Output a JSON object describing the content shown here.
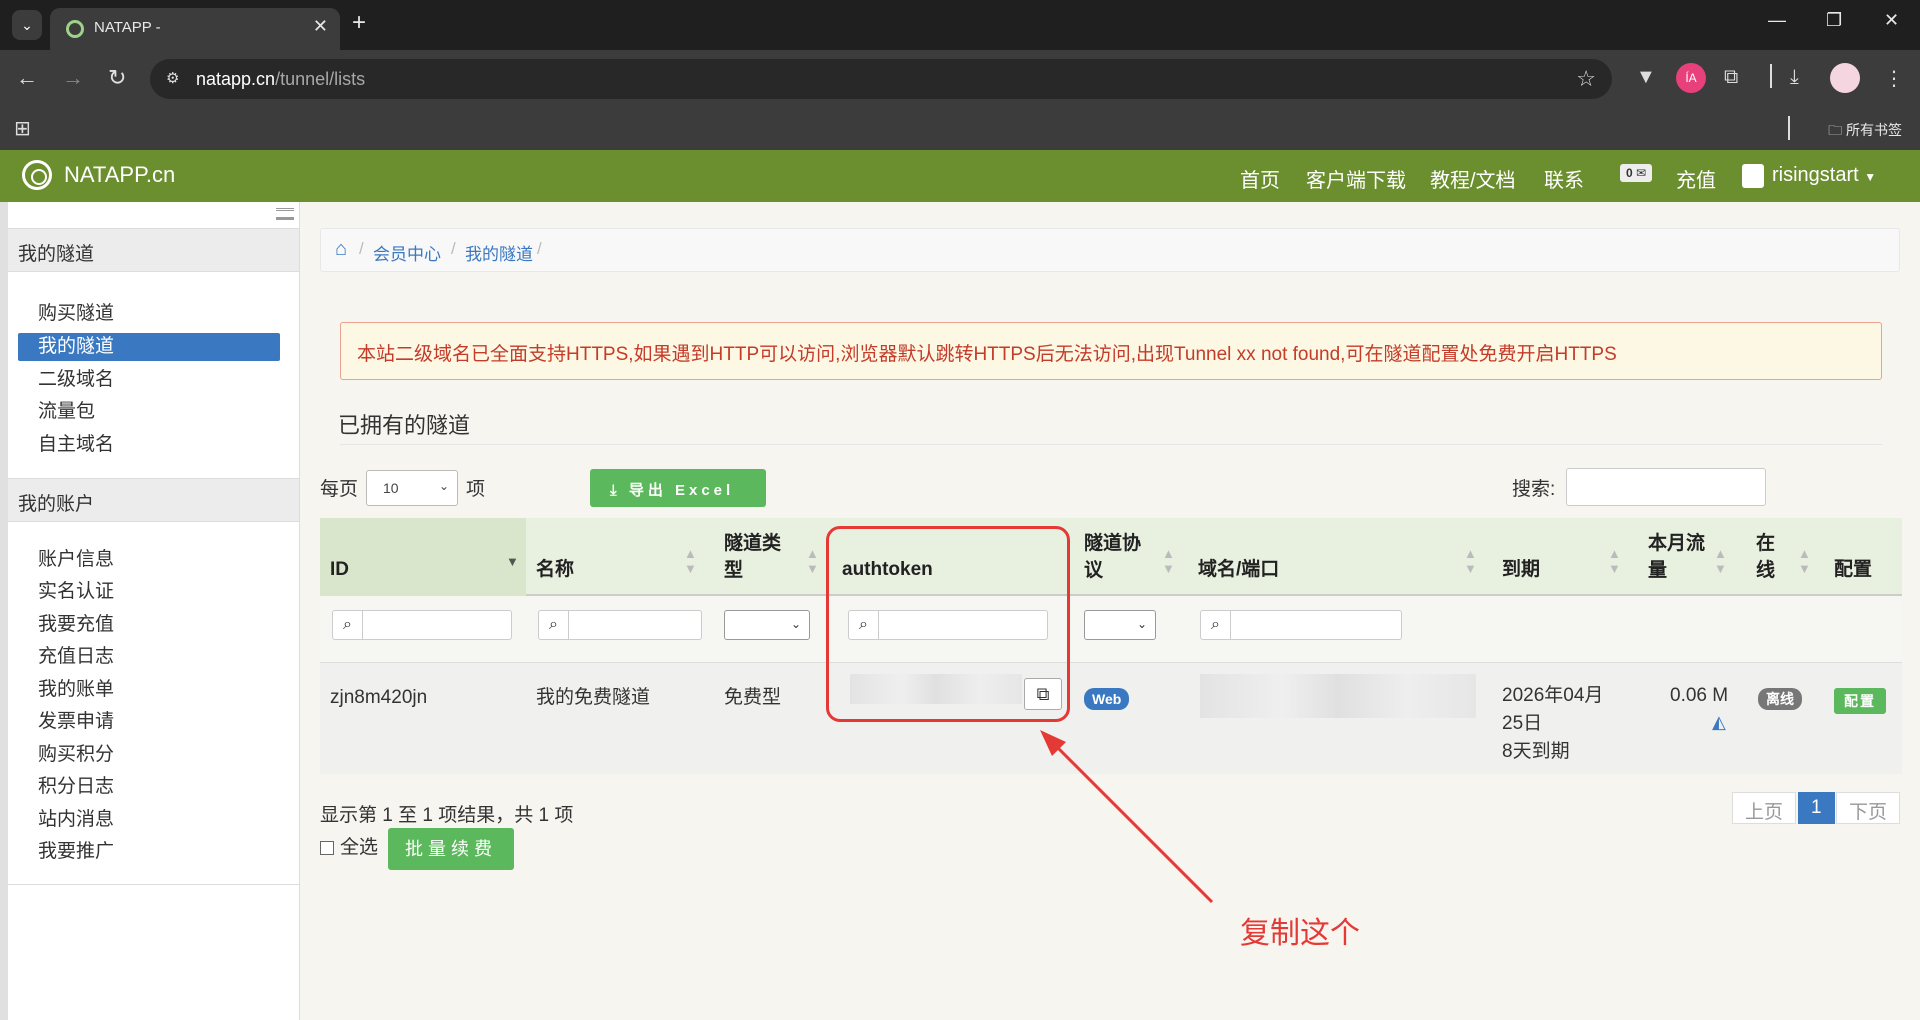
{
  "browser": {
    "tab_title": "NATAPP -",
    "tab_close": "✕",
    "tab_new": "+",
    "url_host": "natapp.cn",
    "url_path": "/tunnel/lists",
    "bookmark_all": "所有书签",
    "ext_badge_text": "ÍA"
  },
  "site": {
    "brand": "NATAPP.cn",
    "nav": [
      "首页",
      "客户端下载",
      "教程/文档",
      "联系"
    ],
    "wallet_count": "0",
    "recharge": "充值",
    "username": "risingstart",
    "colors": {
      "header": "#6b8e2f",
      "accent": "#3a78c2",
      "success": "#5cb85c",
      "alert_text": "#c43b2a",
      "annotation": "#e53935"
    }
  },
  "sidebar": {
    "group1": "我的隧道",
    "group1_items": [
      "购买隧道",
      "我的隧道",
      "二级域名",
      "流量包",
      "自主域名"
    ],
    "active": "我的隧道",
    "group2": "我的账户",
    "group2_items": [
      "账户信息",
      "实名认证",
      "我要充值",
      "充值日志",
      "我的账单",
      "发票申请",
      "购买积分",
      "积分日志",
      "站内消息",
      "我要推广"
    ]
  },
  "breadcrumb": [
    "会员中心",
    "我的隧道"
  ],
  "alert": "本站二级域名已全面支持HTTPS,如果遇到HTTP可以访问,浏览器默认跳转HTTPS后无法访问,出现Tunnel xx not found,可在隧道配置处免费开启HTTPS",
  "section_title": "已拥有的隧道",
  "controls": {
    "per_page_prefix": "每页",
    "per_page_value": "10",
    "per_page_suffix": "项",
    "export_label": "导出 Excel",
    "search_label": "搜索:"
  },
  "table": {
    "headers": {
      "id": "ID",
      "name": "名称",
      "type_l1": "隧道类",
      "type_l2": "型",
      "authtoken": "authtoken",
      "proto_l1": "隧道协",
      "proto_l2": "议",
      "domain": "域名/端口",
      "expire": "到期",
      "traffic_l1": "本月流",
      "traffic_l2": "量",
      "online_l1": "在",
      "online_l2": "线",
      "config": "配置"
    },
    "row": {
      "id": "zjn8m420jn",
      "name": "我的免费隧道",
      "type": "免费型",
      "protocol": "Web",
      "expire_l1": "2026年04月",
      "expire_l2": "25日",
      "expire_l3": "8天到期",
      "traffic": "0.06 M",
      "online": "离线",
      "config": "配置"
    }
  },
  "footer": {
    "info": "显示第 1 至 1 项结果，共 1 项",
    "prev": "上页",
    "page": "1",
    "next": "下页",
    "select_all": "全选",
    "batch_renew": "批量续费"
  },
  "annotation": {
    "note": "复制这个"
  }
}
